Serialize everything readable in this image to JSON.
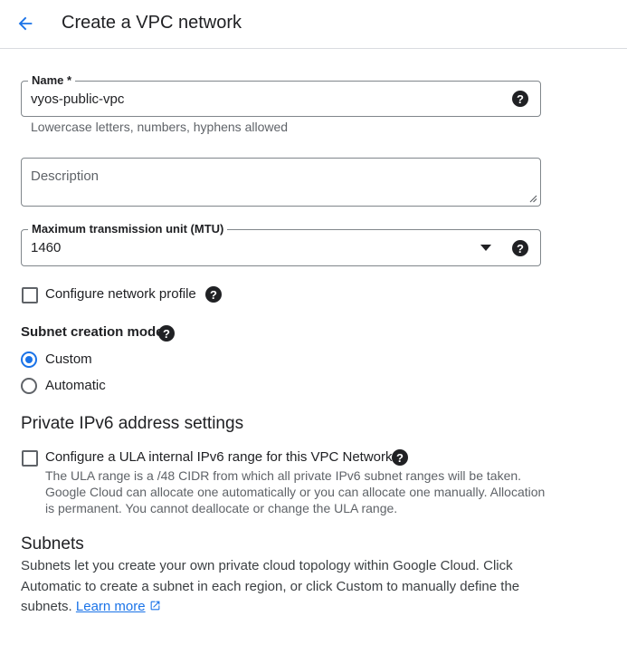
{
  "header": {
    "title": "Create a VPC network",
    "back_icon": "arrow-back-icon"
  },
  "name_field": {
    "label": "Name *",
    "value": "vyos-public-vpc",
    "hint": "Lowercase letters, numbers, hyphens allowed",
    "help_icon": "help-icon"
  },
  "description_field": {
    "placeholder": "Description",
    "resize_icon": "resize-handle-icon"
  },
  "mtu_field": {
    "label": "Maximum transmission unit (MTU)",
    "value": "1460",
    "dropdown_icon": "dropdown-arrow-icon",
    "help_icon": "help-icon"
  },
  "network_profile": {
    "label": "Configure network profile",
    "checked": false,
    "help_icon": "help-icon"
  },
  "subnet_mode": {
    "label": "Subnet creation mode",
    "help_icon": "help-icon",
    "options": [
      {
        "label": "Custom",
        "selected": true
      },
      {
        "label": "Automatic",
        "selected": false
      }
    ]
  },
  "ipv6": {
    "title": "Private IPv6 address settings",
    "checkbox_label": "Configure a ULA internal IPv6 range for this VPC Network",
    "checked": false,
    "help_icon": "help-icon",
    "description": "The ULA range is a /48 CIDR from which all private IPv6 subnet ranges will be taken. Google Cloud can allocate one automatically or you can allocate one manually. Allocation is permanent. You cannot deallocate or change the ULA range."
  },
  "subnets": {
    "title": "Subnets",
    "description": "Subnets let you create your own private cloud topology within Google Cloud. Click Automatic to create a subnet in each region, or click Custom to manually define the subnets.",
    "link_text": "Learn more",
    "link_icon": "external-link-icon"
  },
  "colors": {
    "accent": "#1a73e8",
    "text": "#202124",
    "secondary_text": "#5f6368",
    "border": "#80868b"
  }
}
